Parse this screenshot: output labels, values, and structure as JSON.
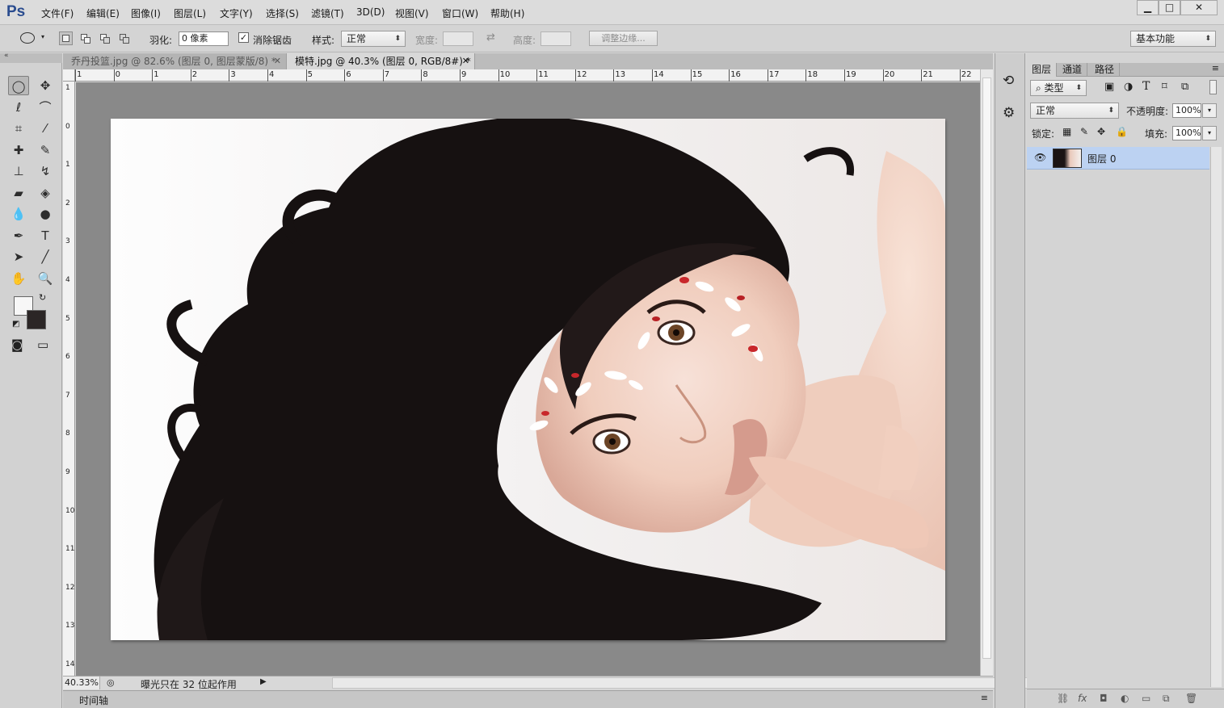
{
  "app": {
    "logo": "Ps"
  },
  "menu": [
    "文件(F)",
    "编辑(E)",
    "图像(I)",
    "图层(L)",
    "文字(Y)",
    "选择(S)",
    "滤镜(T)",
    "3D(D)",
    "视图(V)",
    "窗口(W)",
    "帮助(H)"
  ],
  "window_controls": {
    "minimize": "▁",
    "maximize": "□",
    "close": "✕"
  },
  "options": {
    "feather_label": "羽化:",
    "feather_value": "0 像素",
    "antialias_label": "消除锯齿",
    "antialias_checked": true,
    "style_label": "样式:",
    "style_value": "正常",
    "width_label": "宽度:",
    "height_label": "高度:",
    "refine_edge": "调整边缘...",
    "workspace": "基本功能"
  },
  "tabs": [
    {
      "label": "乔丹投篮.jpg @ 82.6% (图层 0, 图层蒙版/8) *",
      "active": false
    },
    {
      "label": "模特.jpg @ 40.3% (图层 0, RGB/8#) *",
      "active": true
    }
  ],
  "ruler_top": [
    "1",
    "0",
    "1",
    "2",
    "3",
    "4",
    "5",
    "6",
    "7",
    "8",
    "9",
    "10",
    "11",
    "12",
    "13",
    "14",
    "15",
    "16",
    "17",
    "18",
    "19",
    "20",
    "21",
    "22"
  ],
  "ruler_left": [
    "1",
    "0",
    "1",
    "2",
    "3",
    "4",
    "5",
    "6",
    "7",
    "8",
    "9",
    "10",
    "11",
    "12",
    "13",
    "14"
  ],
  "status": {
    "zoom": "40.33%",
    "message": "曝光只在 32 位起作用"
  },
  "timeline_label": "时间轴",
  "tools": [
    {
      "name": "elliptical-marquee-tool-icon",
      "glyph": "◯"
    },
    {
      "name": "move-tool-icon",
      "glyph": "✥"
    },
    {
      "name": "lasso-tool-icon",
      "glyph": "ℓ"
    },
    {
      "name": "quick-selection-tool-icon",
      "glyph": "⌒"
    },
    {
      "name": "crop-tool-icon",
      "glyph": "⌗"
    },
    {
      "name": "eyedropper-tool-icon",
      "glyph": "⁄"
    },
    {
      "name": "spot-healing-brush-icon",
      "glyph": "✚"
    },
    {
      "name": "brush-tool-icon",
      "glyph": "✎"
    },
    {
      "name": "clone-stamp-tool-icon",
      "glyph": "⊥"
    },
    {
      "name": "history-brush-icon",
      "glyph": "↯"
    },
    {
      "name": "eraser-tool-icon",
      "glyph": "▰"
    },
    {
      "name": "paint-bucket-tool-icon",
      "glyph": "◈"
    },
    {
      "name": "blur-tool-icon",
      "glyph": "💧"
    },
    {
      "name": "dodge-tool-icon",
      "glyph": "●"
    },
    {
      "name": "pen-tool-icon",
      "glyph": "✒"
    },
    {
      "name": "type-tool-icon",
      "glyph": "T"
    },
    {
      "name": "path-selection-tool-icon",
      "glyph": "➤"
    },
    {
      "name": "line-tool-icon",
      "glyph": "╱"
    },
    {
      "name": "hand-tool-icon",
      "glyph": "✋"
    },
    {
      "name": "zoom-tool-icon",
      "glyph": "🔍"
    }
  ],
  "layers_panel": {
    "tabs": [
      "图层",
      "通道",
      "路径"
    ],
    "filter_kind": "类型",
    "blend_mode": "正常",
    "opacity_label": "不透明度:",
    "opacity_value": "100%",
    "lock_label": "锁定:",
    "fill_label": "填充:",
    "fill_value": "100%",
    "layers": [
      {
        "name": "图层 0",
        "visible": true
      }
    ]
  }
}
